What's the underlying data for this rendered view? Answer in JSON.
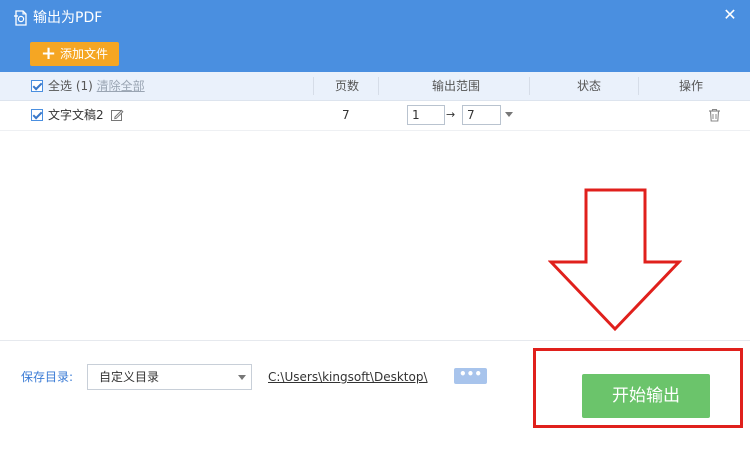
{
  "window": {
    "title": "输出为PDF",
    "close_glyph": "✕"
  },
  "toolbar": {
    "add_label": "添加文件",
    "add_glyph": "+"
  },
  "table": {
    "select_all_label": "全选",
    "select_count": "(1)",
    "clear_all_label": "清除全部",
    "headers": {
      "pages": "页数",
      "range": "输出范围",
      "status": "状态",
      "action": "操作"
    },
    "rows": [
      {
        "checked": true,
        "name": "文字文稿2",
        "pages": "7",
        "range_from": "1",
        "range_arrow": "→",
        "range_to": "7",
        "status": ""
      }
    ]
  },
  "footer": {
    "save_dir_label": "保存目录:",
    "dir_mode": "自定义目录",
    "path": "C:\\Users\\kingsoft\\Desktop\\",
    "browse_label": "•••",
    "start_label": "开始输出"
  },
  "colors": {
    "header": "#4a8fe0",
    "add_button": "#f5a623",
    "start_button": "#6bc46b",
    "annotation": "#e0201c"
  },
  "icons": [
    "pdf-export-icon",
    "close-icon",
    "checkbox-icon",
    "edit-icon",
    "trash-icon",
    "dropdown-caret-icon"
  ]
}
